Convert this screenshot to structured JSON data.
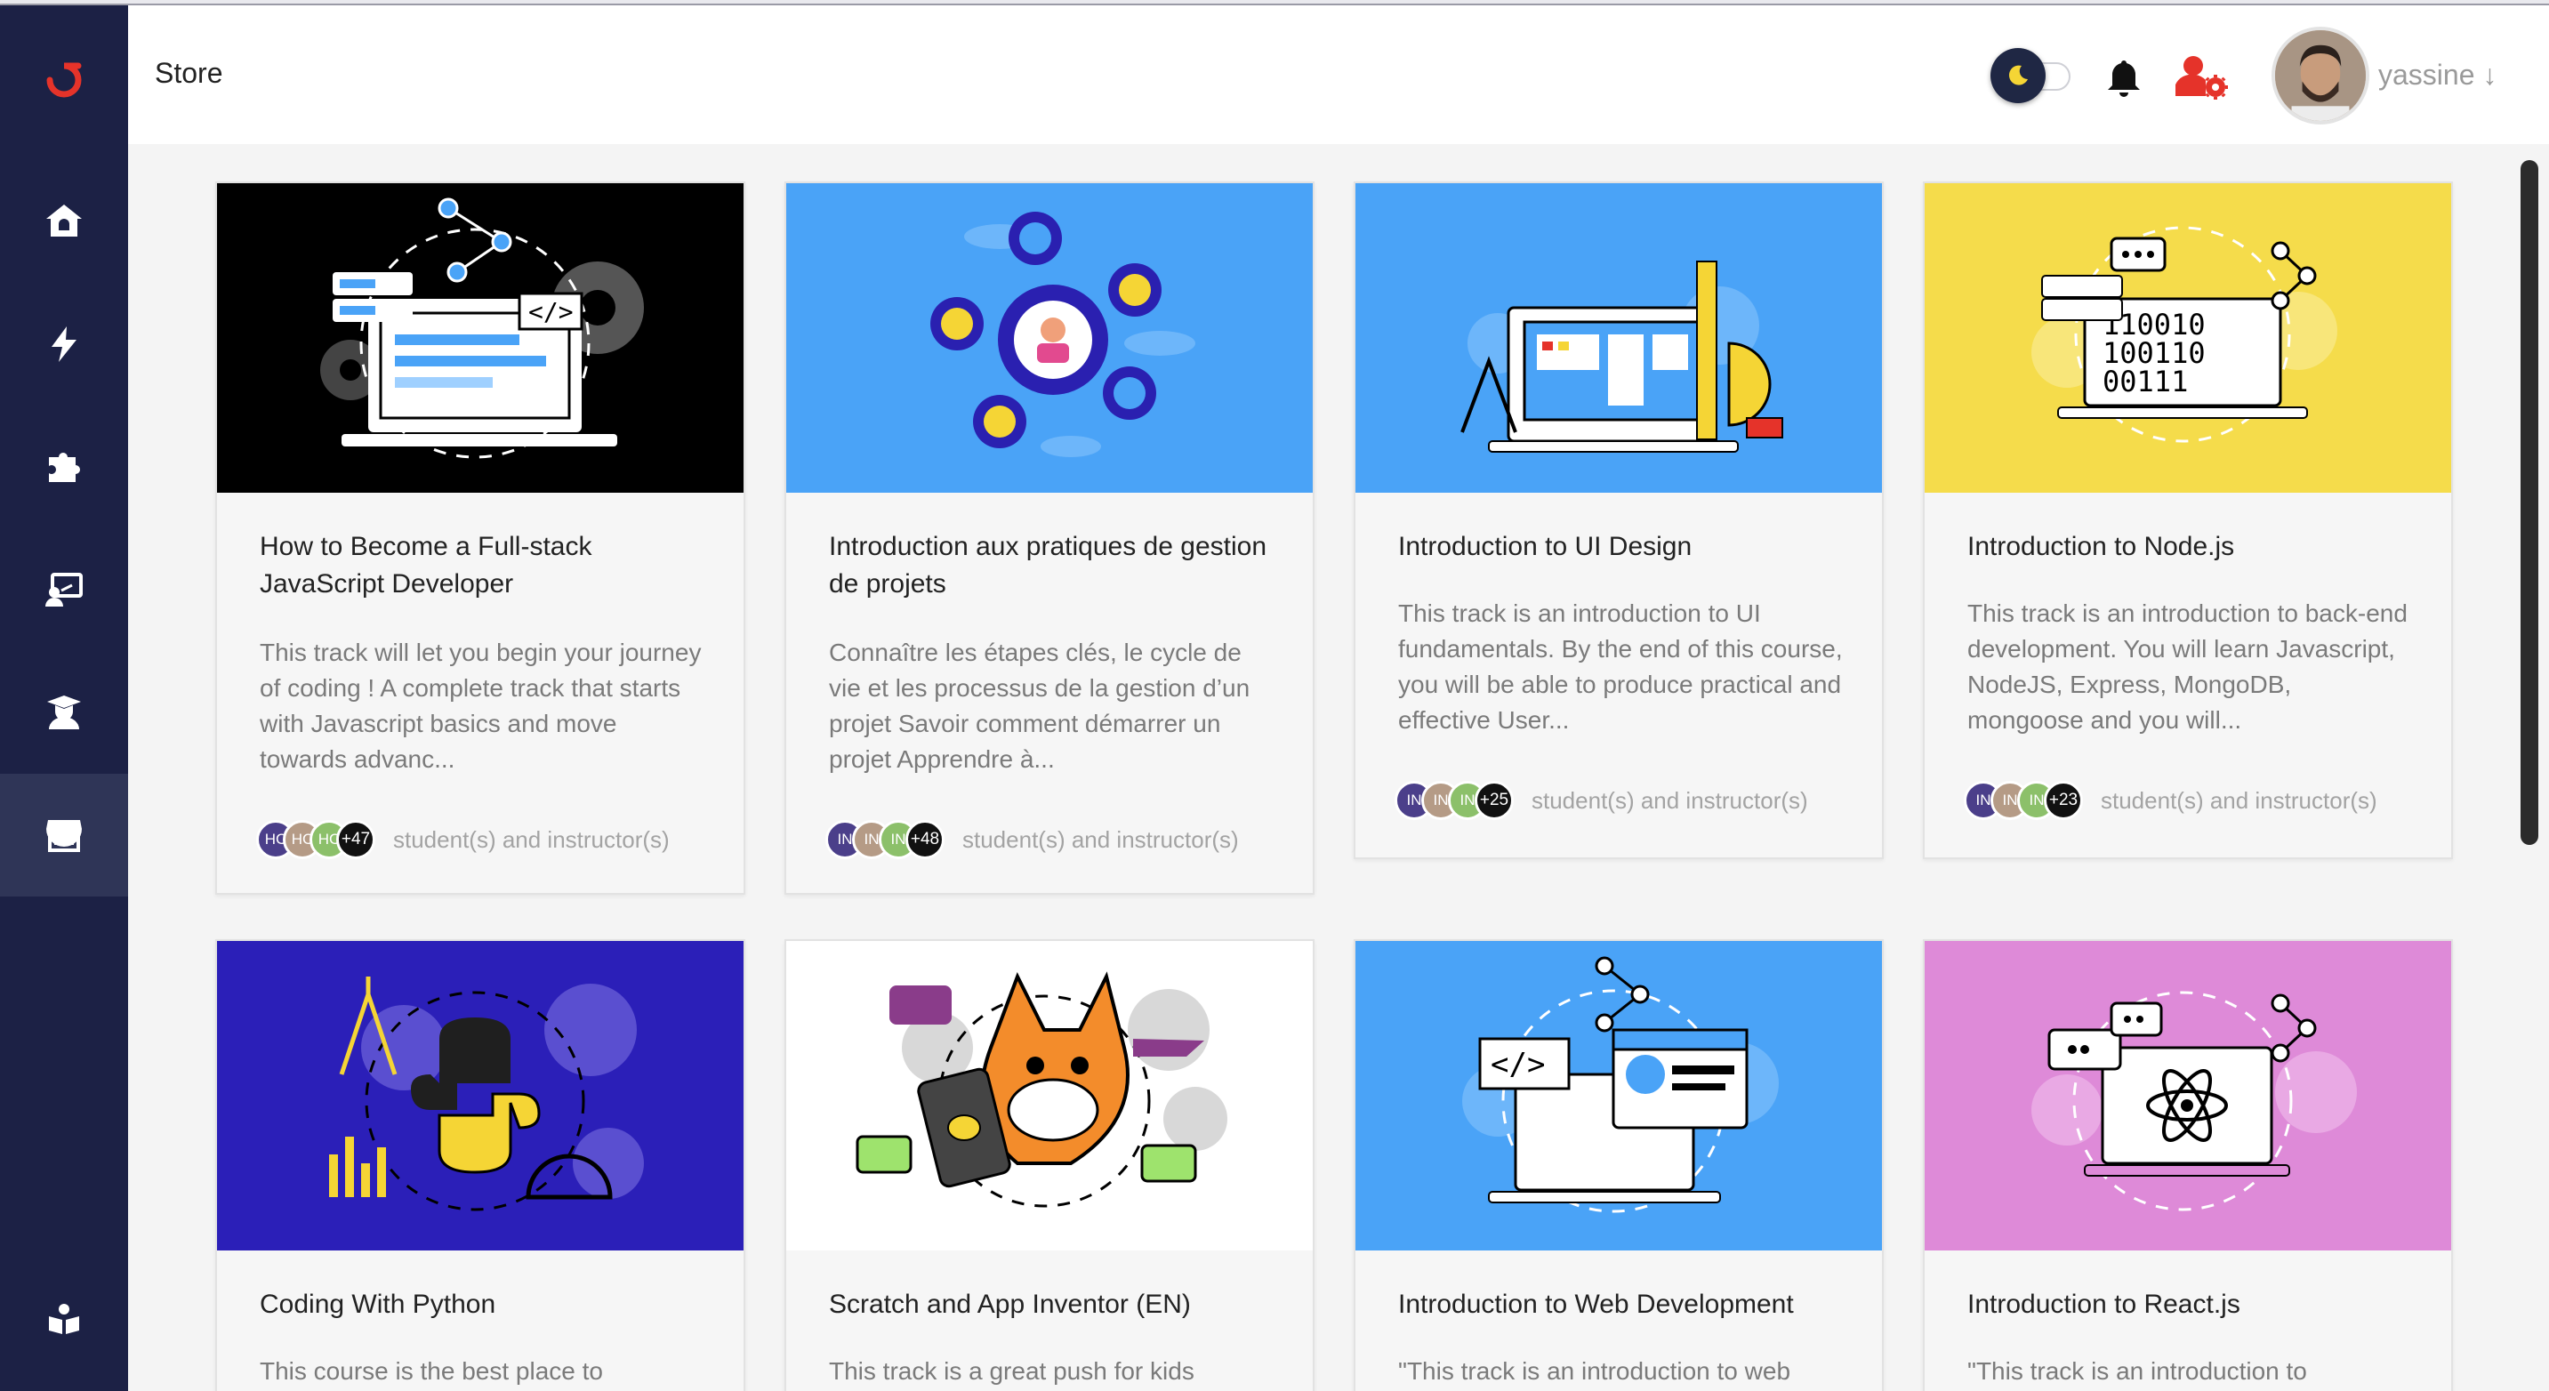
{
  "header": {
    "page_title": "Store",
    "username": "yassine",
    "username_arrow": "↓"
  },
  "colors": {
    "sidebar": "#1c2145",
    "accent_red": "#e5332a",
    "thumb_blue": "#4aa3f7",
    "thumb_yellow": "#f5dc4b",
    "thumb_purple": "#2b1fb8",
    "thumb_pink": "#de8ad8"
  },
  "sidebar": {
    "logo": "brand-logo-icon",
    "items": [
      {
        "icon": "home-icon"
      },
      {
        "icon": "bolt-icon"
      },
      {
        "icon": "puzzle-icon"
      },
      {
        "icon": "instructor-icon"
      },
      {
        "icon": "graduate-icon"
      },
      {
        "icon": "store-icon",
        "active": true
      },
      {
        "icon": "support-icon"
      }
    ]
  },
  "cards": [
    {
      "title": "How to Become a Full-stack JavaScript Developer",
      "description": "This track will let you begin your journey of coding ! A complete track that starts with Javascript basics and move towards advanc...",
      "avatars": [
        "HC",
        "HC",
        "HC"
      ],
      "count": "+47",
      "members_label": "student(s) and instructor(s)"
    },
    {
      "title": "Introduction aux pratiques de gestion de projets",
      "description": "Connaître les étapes clés, le cycle de vie et les processus de la gestion d’un projet Savoir comment démarrer un projet Apprendre à...",
      "avatars": [
        "IN",
        "IN",
        "IN"
      ],
      "count": "+48",
      "members_label": "student(s) and instructor(s)"
    },
    {
      "title": "Introduction to UI Design",
      "description": "This track is an introduction to UI fundamentals. By the end of this course, you will be able to produce practical and effective User...",
      "avatars": [
        "IN",
        "IN",
        "IN"
      ],
      "count": "+25",
      "members_label": "student(s) and instructor(s)"
    },
    {
      "title": "Introduction to Node.js",
      "description": "This track is an introduction to back-end development. You will learn Javascript, NodeJS, Express, MongoDB, mongoose and you will...",
      "avatars": [
        "IN",
        "IN",
        "IN"
      ],
      "count": "+23",
      "members_label": "student(s) and instructor(s)"
    },
    {
      "title": "Coding With Python",
      "description": "This course is the best place to"
    },
    {
      "title": "Scratch and App Inventor (EN)",
      "description": "This track is a great push for kids"
    },
    {
      "title": "Introduction to Web Development",
      "description": "\"This track is an introduction to web"
    },
    {
      "title": "Introduction to React.js",
      "description": "\"This track is an introduction to"
    }
  ]
}
